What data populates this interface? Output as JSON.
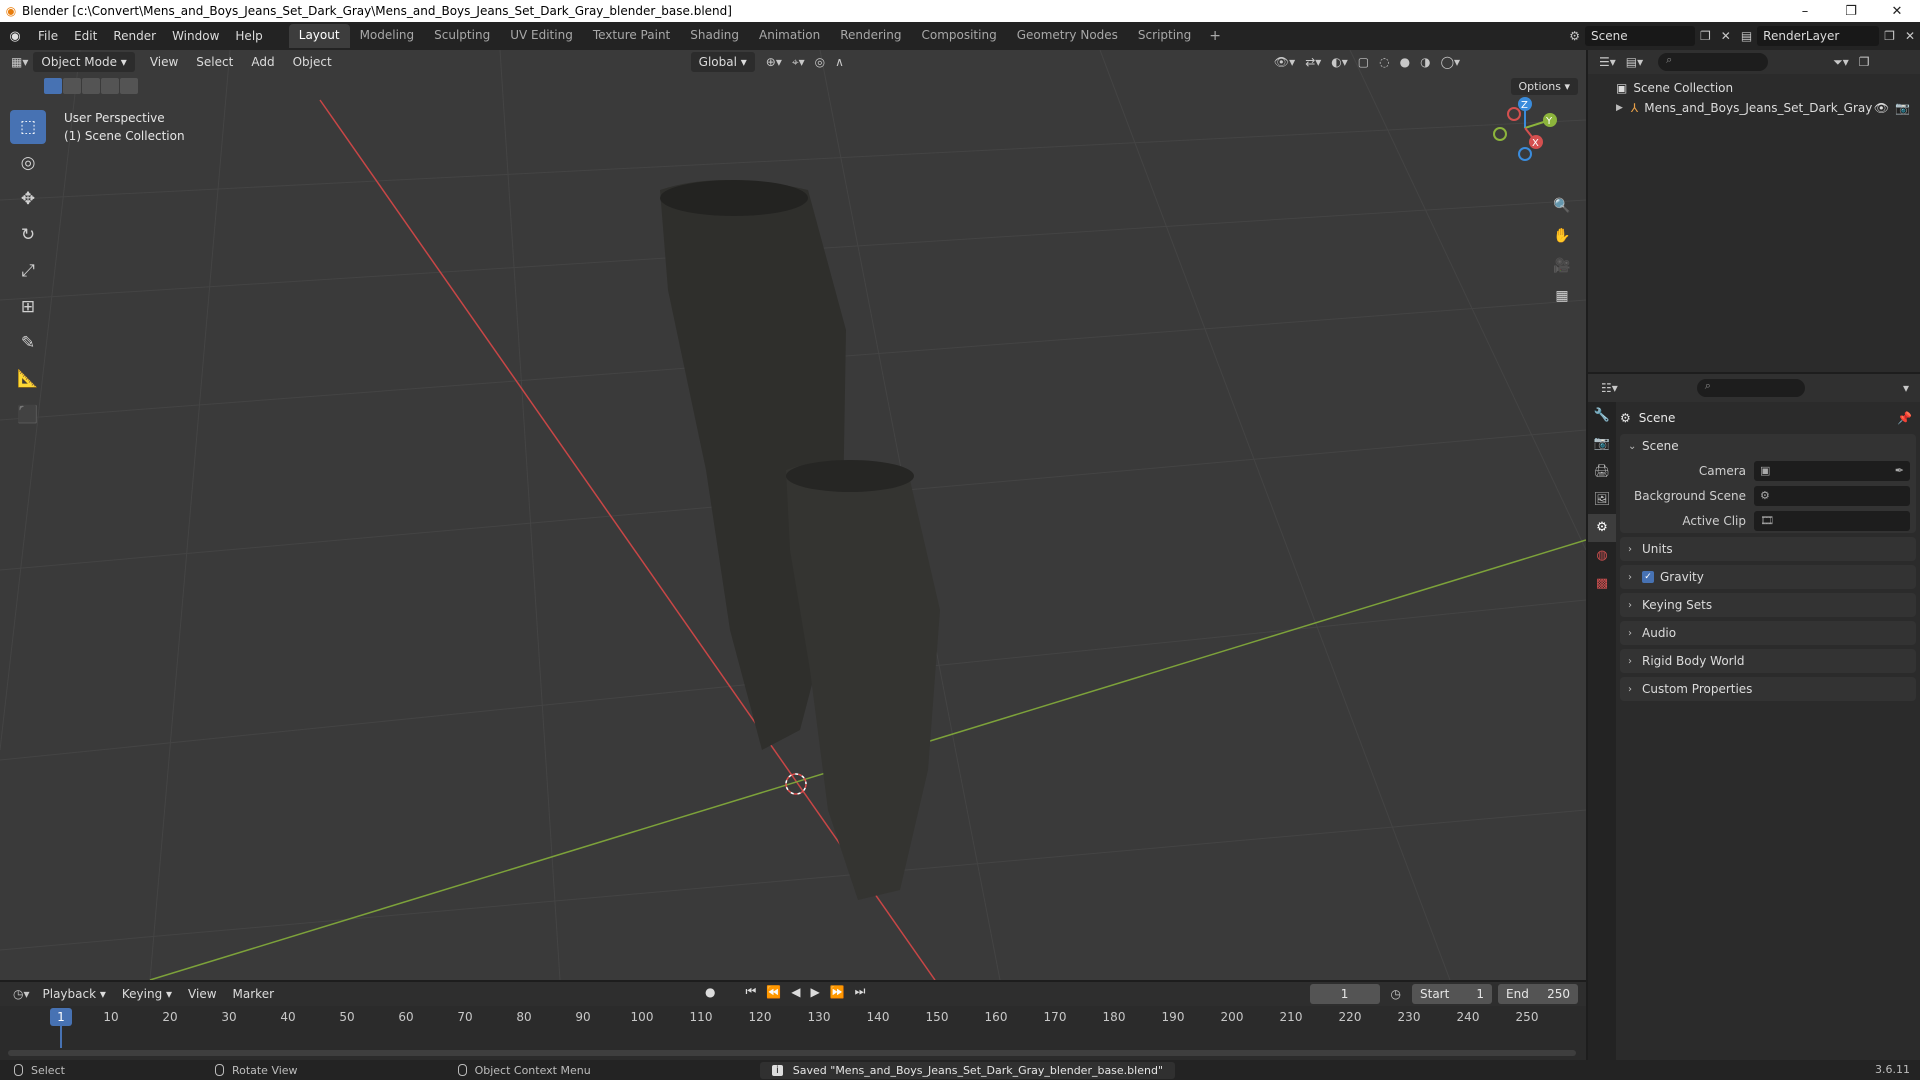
{
  "window": {
    "title": "Blender [c:\\Convert\\Mens_and_Boys_Jeans_Set_Dark_Gray\\Mens_and_Boys_Jeans_Set_Dark_Gray_blender_base.blend]",
    "minimize": "–",
    "maximize": "❐",
    "close": "✕"
  },
  "menu": [
    "File",
    "Edit",
    "Render",
    "Window",
    "Help"
  ],
  "workspaces": [
    "Layout",
    "Modeling",
    "Sculpting",
    "UV Editing",
    "Texture Paint",
    "Shading",
    "Animation",
    "Rendering",
    "Compositing",
    "Geometry Nodes",
    "Scripting"
  ],
  "active_workspace": "Layout",
  "scene_field": "Scene",
  "renderlayer_field": "RenderLayer",
  "viewport": {
    "mode": "Object Mode",
    "menus": [
      "View",
      "Select",
      "Add",
      "Object"
    ],
    "transform_orientation": "Global",
    "options": "Options",
    "overlay_line1": "User Perspective",
    "overlay_line2": "(1) Scene Collection",
    "gizmo": {
      "x": "X",
      "y": "Y",
      "z": "Z"
    }
  },
  "outliner": {
    "root": "Scene Collection",
    "items": [
      {
        "label": "Mens_and_Boys_Jeans_Set_Dark_Gray"
      }
    ]
  },
  "properties": {
    "context_title": "Scene",
    "panel_scene": "Scene",
    "rows": [
      {
        "label": "Camera"
      },
      {
        "label": "Background Scene"
      },
      {
        "label": "Active Clip"
      }
    ],
    "collapsed_panels": [
      "Units",
      "Gravity",
      "Keying Sets",
      "Audio",
      "Rigid Body World",
      "Custom Properties"
    ]
  },
  "timeline": {
    "menus": [
      "Playback",
      "Keying",
      "View",
      "Marker"
    ],
    "current_frame": "1",
    "start_label": "Start",
    "start": "1",
    "end_label": "End",
    "end": "250",
    "ticks": [
      "1",
      "10",
      "20",
      "30",
      "40",
      "50",
      "60",
      "70",
      "80",
      "90",
      "100",
      "110",
      "120",
      "130",
      "140",
      "150",
      "160",
      "170",
      "180",
      "190",
      "200",
      "210",
      "220",
      "230",
      "240",
      "250"
    ]
  },
  "status": {
    "select": "Select",
    "rotate": "Rotate View",
    "context_menu": "Object Context Menu",
    "saved": "Saved \"Mens_and_Boys_Jeans_Set_Dark_Gray_blender_base.blend\"",
    "version": "3.6.11"
  },
  "colors": {
    "accent": "#4772b3",
    "x_axis": "#d4504f",
    "y_axis": "#8cb43c",
    "z_axis": "#3a8cdc"
  }
}
